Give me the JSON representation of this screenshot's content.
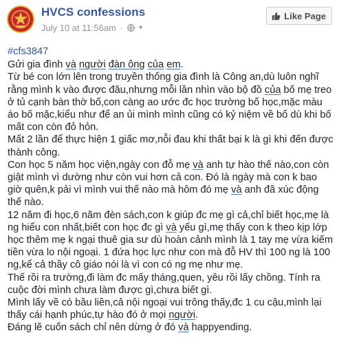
{
  "header": {
    "page_name": "HVCS confessions",
    "timestamp": "July 10 at 11:56am",
    "like_button": "Like Page",
    "accent_color": "#365899"
  },
  "post": {
    "hashtag": "#cfs3847",
    "p1": {
      "a": "Gửi gia đình ",
      "b": "và",
      "c": " ",
      "d": "người",
      "e": " ",
      "f": "đàn ông",
      "g": " ",
      "h": "của",
      "i": " ",
      "j": "em",
      "k": "."
    },
    "p2": {
      "a": "Từ bé con lớn lên trong truyền thống gia đình là Công an,dù luôn nghĩ rằng mình k vào được đâu,nhưng mỗi lần nhìn vào bộ đồ ",
      "b": "của",
      "c": " bố mẹ treo ở tủ cạnh bàn thờ bố,con càng ao ước đc học trường bố học,mặc màu áo bố mặc,kiểu như để an ủi mình mình cũng có kỷ niệm về bố dù khi bố mất con còn đỏ hỏn."
    },
    "p3": "Mất 2 lần để thực hiện 1 giấc mơ,nỗi đau khi thất bại k là gì khi đến được thành công.",
    "p4": {
      "a": "Con học 5 năm học viện,ngày con đỗ mẹ ",
      "b": "và",
      "c": " anh tự hào thế nào,con còn giật mình vì dường như còn vui hơn cả con. Đó là ngày mà con k bao giờ quên,k pải vì mình vui thế nào mà hôm đó mẹ ",
      "d": "và",
      "e": " anh đã xúc động thế nào."
    },
    "p5": {
      "a": "12 năm đi học,6 năm đèn sách,con k giúp đc mẹ gì cả,chỉ biết học,mẹ là ng hiểu con nhất,biết con học đc gì ",
      "b": "và",
      "c": " yếu gì,mẹ thấy con k theo kịp lớp học thêm mẹ k ngại thuê gia sư dù hoàn cảnh mình là 1 tay mẹ vừa kiếm tiền vừa lo nội ngoại. 1 đứa học lực như con mà đỗ HV thì 100 ng là 100 ng,kể cả thầy cô giáo nói là vì con có ng mẹ như mẹ."
    },
    "p6": "Thế rồi ra trường,đi làm đc mấy tháng,quen, yêu rồi lấy chồng. Tính ra cuộc đời mình chưa làm được gì,chưa biết gì.",
    "p7": {
      "a": "Mình lấy về có bầu liền,cả nội ngoại vui trông thấy,đc 1 cu cậu,mình lại thấy cái hạnh phúc,tự hào đó ở mọi ",
      "b": "người",
      "c": "."
    },
    "p8": {
      "a": "Đáng lẽ cuốn sách chỉ nên dừng ở đó ",
      "b": "và",
      "c": " happyending."
    }
  }
}
